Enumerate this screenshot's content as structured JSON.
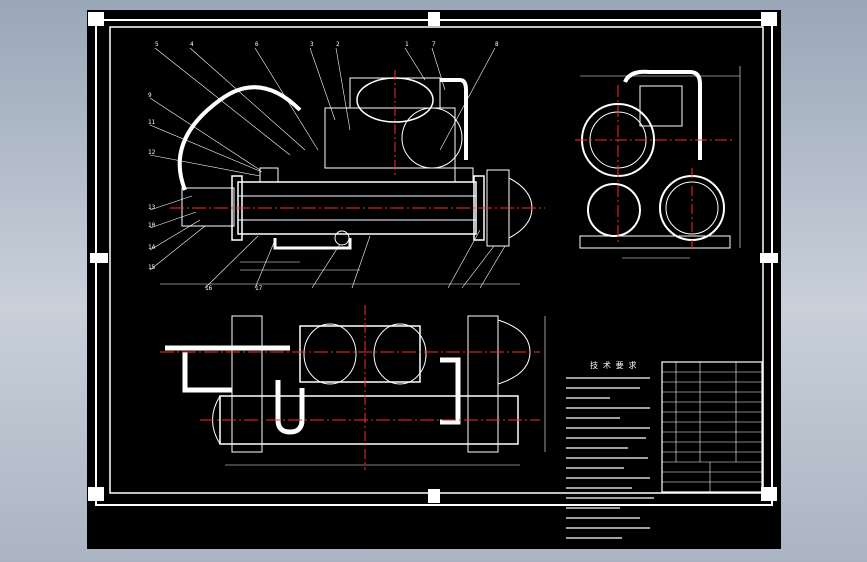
{
  "viewport": {
    "background": "#000000"
  },
  "colors": {
    "line": "#ffffff",
    "centerline": "#ff2a2a",
    "frame": "#ffffff"
  },
  "notes": {
    "heading": "技 术 要 求"
  },
  "balloons_front": [
    "5",
    "4",
    "6",
    "3",
    "2",
    "1",
    "7",
    "8",
    "9"
  ],
  "balloons_left": [
    "11",
    "12",
    "13",
    "10",
    "14",
    "15",
    "16",
    "17"
  ]
}
